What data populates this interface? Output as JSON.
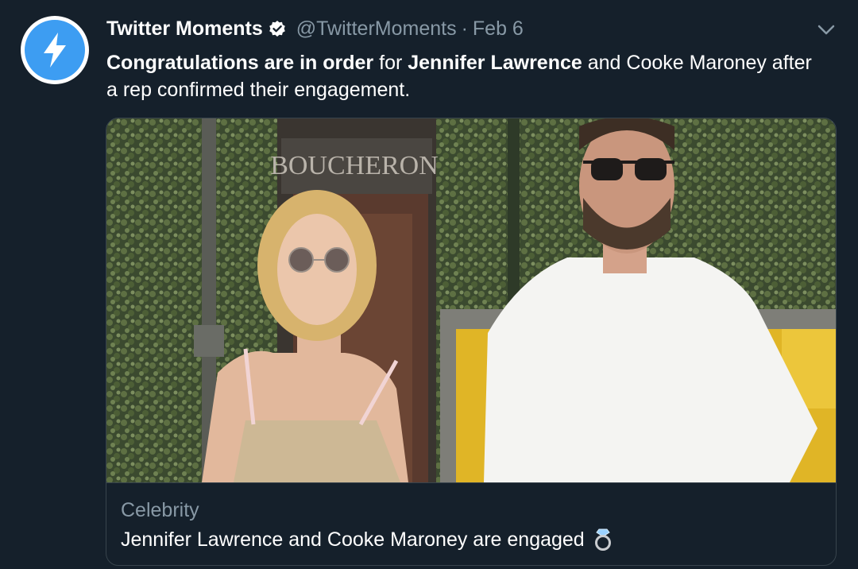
{
  "tweet": {
    "author": {
      "display_name": "Twitter Moments",
      "handle": "@TwitterMoments",
      "verified_icon": "verified-badge-icon",
      "avatar_icon": "lightning-bolt-icon"
    },
    "separator": "·",
    "date": "Feb 6",
    "text": {
      "part1": "Congratulations are in order",
      "part2": " for ",
      "part3": "Jennifer Lawrence",
      "part4": " and Cooke Maroney after a rep confirmed their engagement."
    },
    "menu_icon": "chevron-down-icon"
  },
  "card": {
    "image_alt": "Storefront BOUCHERON sign with couple walking",
    "storefront_sign": "BOUCHERON",
    "category": "Celebrity",
    "title": "Jennifer Lawrence and Cooke Maroney are engaged",
    "title_icon": "ring-icon"
  },
  "colors": {
    "background": "#15202b",
    "accent": "#3d9df2",
    "secondary_text": "#8899a6",
    "border": "#38444d"
  }
}
